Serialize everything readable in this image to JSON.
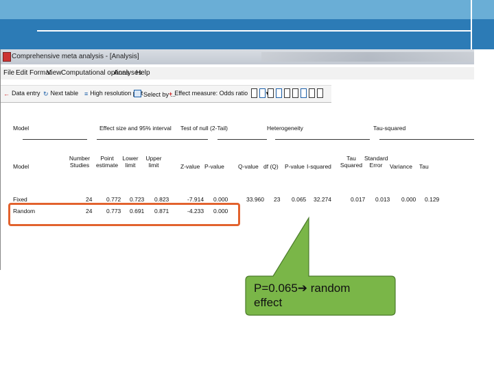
{
  "app": {
    "title": "Comprehensive meta analysis - [Analysis]"
  },
  "menu": [
    "File",
    "Edit",
    "Format",
    "View",
    "Computational options",
    "Analyses",
    "Help"
  ],
  "toolbar": {
    "data_entry": "Data entry",
    "next_table": "Next table",
    "high_res_plot": "High resolution plot",
    "select_by": "Select by ...",
    "effect_measure": "Effect measure: Odds ratio"
  },
  "table": {
    "group_headers": {
      "model": "Model",
      "effect_size": "Effect size and 95% interval",
      "test_of_null": "Test of null (2-Tail)",
      "heterogeneity": "Heterogeneity",
      "tau_squared": "Tau-squared"
    },
    "columns": {
      "model": "Model",
      "number_studies": [
        "Number",
        "Studies"
      ],
      "point_estimate": [
        "Point",
        "estimate"
      ],
      "lower_limit": [
        "Lower",
        "limit"
      ],
      "upper_limit": [
        "Upper",
        "limit"
      ],
      "z_value": "Z-value",
      "p_value": "P-value",
      "q_value": "Q-value",
      "df_q": "df (Q)",
      "p_value_het": "P-value",
      "i_squared": "I-squared",
      "tau_squared": [
        "Tau",
        "Squared"
      ],
      "standard_error": [
        "Standard",
        "Error"
      ],
      "variance": "Variance",
      "tau": "Tau"
    },
    "rows": [
      {
        "model": "Fixed",
        "number_studies": "24",
        "point_estimate": "0.772",
        "lower_limit": "0.723",
        "upper_limit": "0.823",
        "z_value": "-7.914",
        "p_value": "0.000",
        "q_value": "33.960",
        "df_q": "23",
        "p_value_het": "0.065",
        "i_squared": "32.274",
        "tau_squared": "0.017",
        "standard_error": "0.013",
        "variance": "0.000",
        "tau": "0.129"
      },
      {
        "model": "Random",
        "number_studies": "24",
        "point_estimate": "0.773",
        "lower_limit": "0.691",
        "upper_limit": "0.871",
        "z_value": "-4.233",
        "p_value": "0.000"
      }
    ]
  },
  "annotation": {
    "text_line1": "P=0.065➔ random",
    "text_line2": "effect",
    "fill_color": "#7ab648",
    "highlight_color": "#e2622d"
  }
}
